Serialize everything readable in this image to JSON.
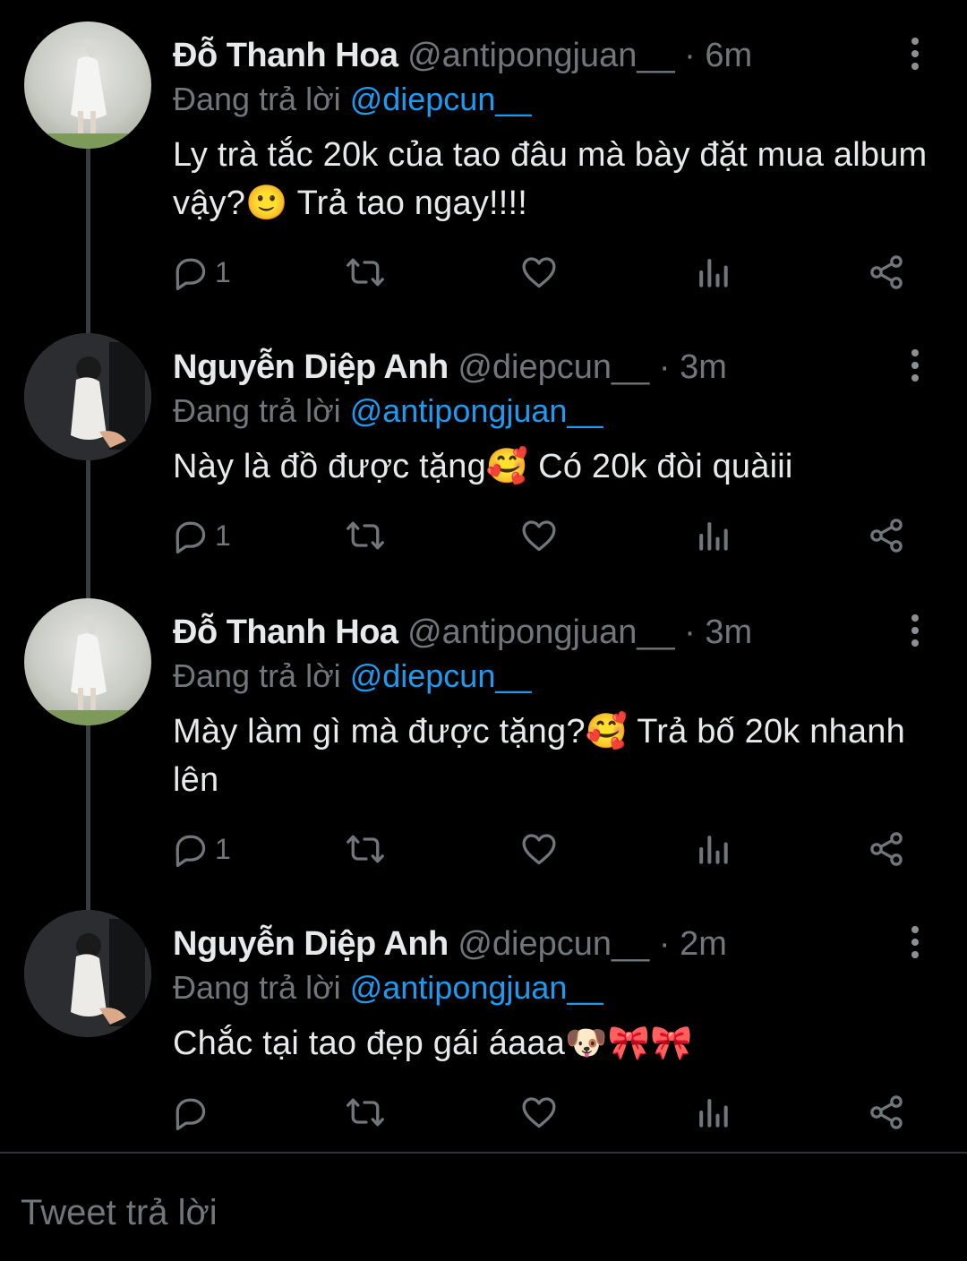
{
  "tweets": [
    {
      "name": "Đỗ Thanh Hoa",
      "handle": "@antipongjuan__",
      "separator": "·",
      "time": "6m",
      "replying_prefix": "Đang trả lời",
      "replying_to": "@diepcun__",
      "text": "Ly trà tắc 20k của tao đâu mà bày đặt mua album vậy?🙂 Trả tao ngay!!!!",
      "reply_count": "1",
      "avatar": "hoa"
    },
    {
      "name": "Nguyễn Diệp Anh",
      "handle": "@diepcun__",
      "separator": "·",
      "time": "3m",
      "replying_prefix": "Đang trả lời",
      "replying_to": "@antipongjuan__",
      "text": "Này là đồ được tặng🥰 Có 20k đòi quàiii",
      "reply_count": "1",
      "avatar": "diep"
    },
    {
      "name": "Đỗ Thanh Hoa",
      "handle": "@antipongjuan__",
      "separator": "·",
      "time": "3m",
      "replying_prefix": "Đang trả lời",
      "replying_to": "@diepcun__",
      "text": "Mày làm gì mà được tặng?🥰 Trả bố 20k nhanh lên",
      "reply_count": "1",
      "avatar": "hoa"
    },
    {
      "name": "Nguyễn Diệp Anh",
      "handle": "@diepcun__",
      "separator": "·",
      "time": "2m",
      "replying_prefix": "Đang trả lời",
      "replying_to": "@antipongjuan__",
      "text": "Chắc tại tao đẹp gái áaaa🐶🎀🎀",
      "reply_count": "",
      "avatar": "diep"
    }
  ],
  "icons": {
    "reply": "reply-icon",
    "retweet": "retweet-icon",
    "like": "heart-icon",
    "stats": "stats-icon",
    "share": "share-icon",
    "more": "more-vertical-icon"
  },
  "colors": {
    "background": "#000000",
    "text": "#e7e9ea",
    "muted": "#71767b",
    "mention": "#1d9bf0"
  },
  "reply_box": {
    "placeholder": "Tweet trả lời"
  }
}
